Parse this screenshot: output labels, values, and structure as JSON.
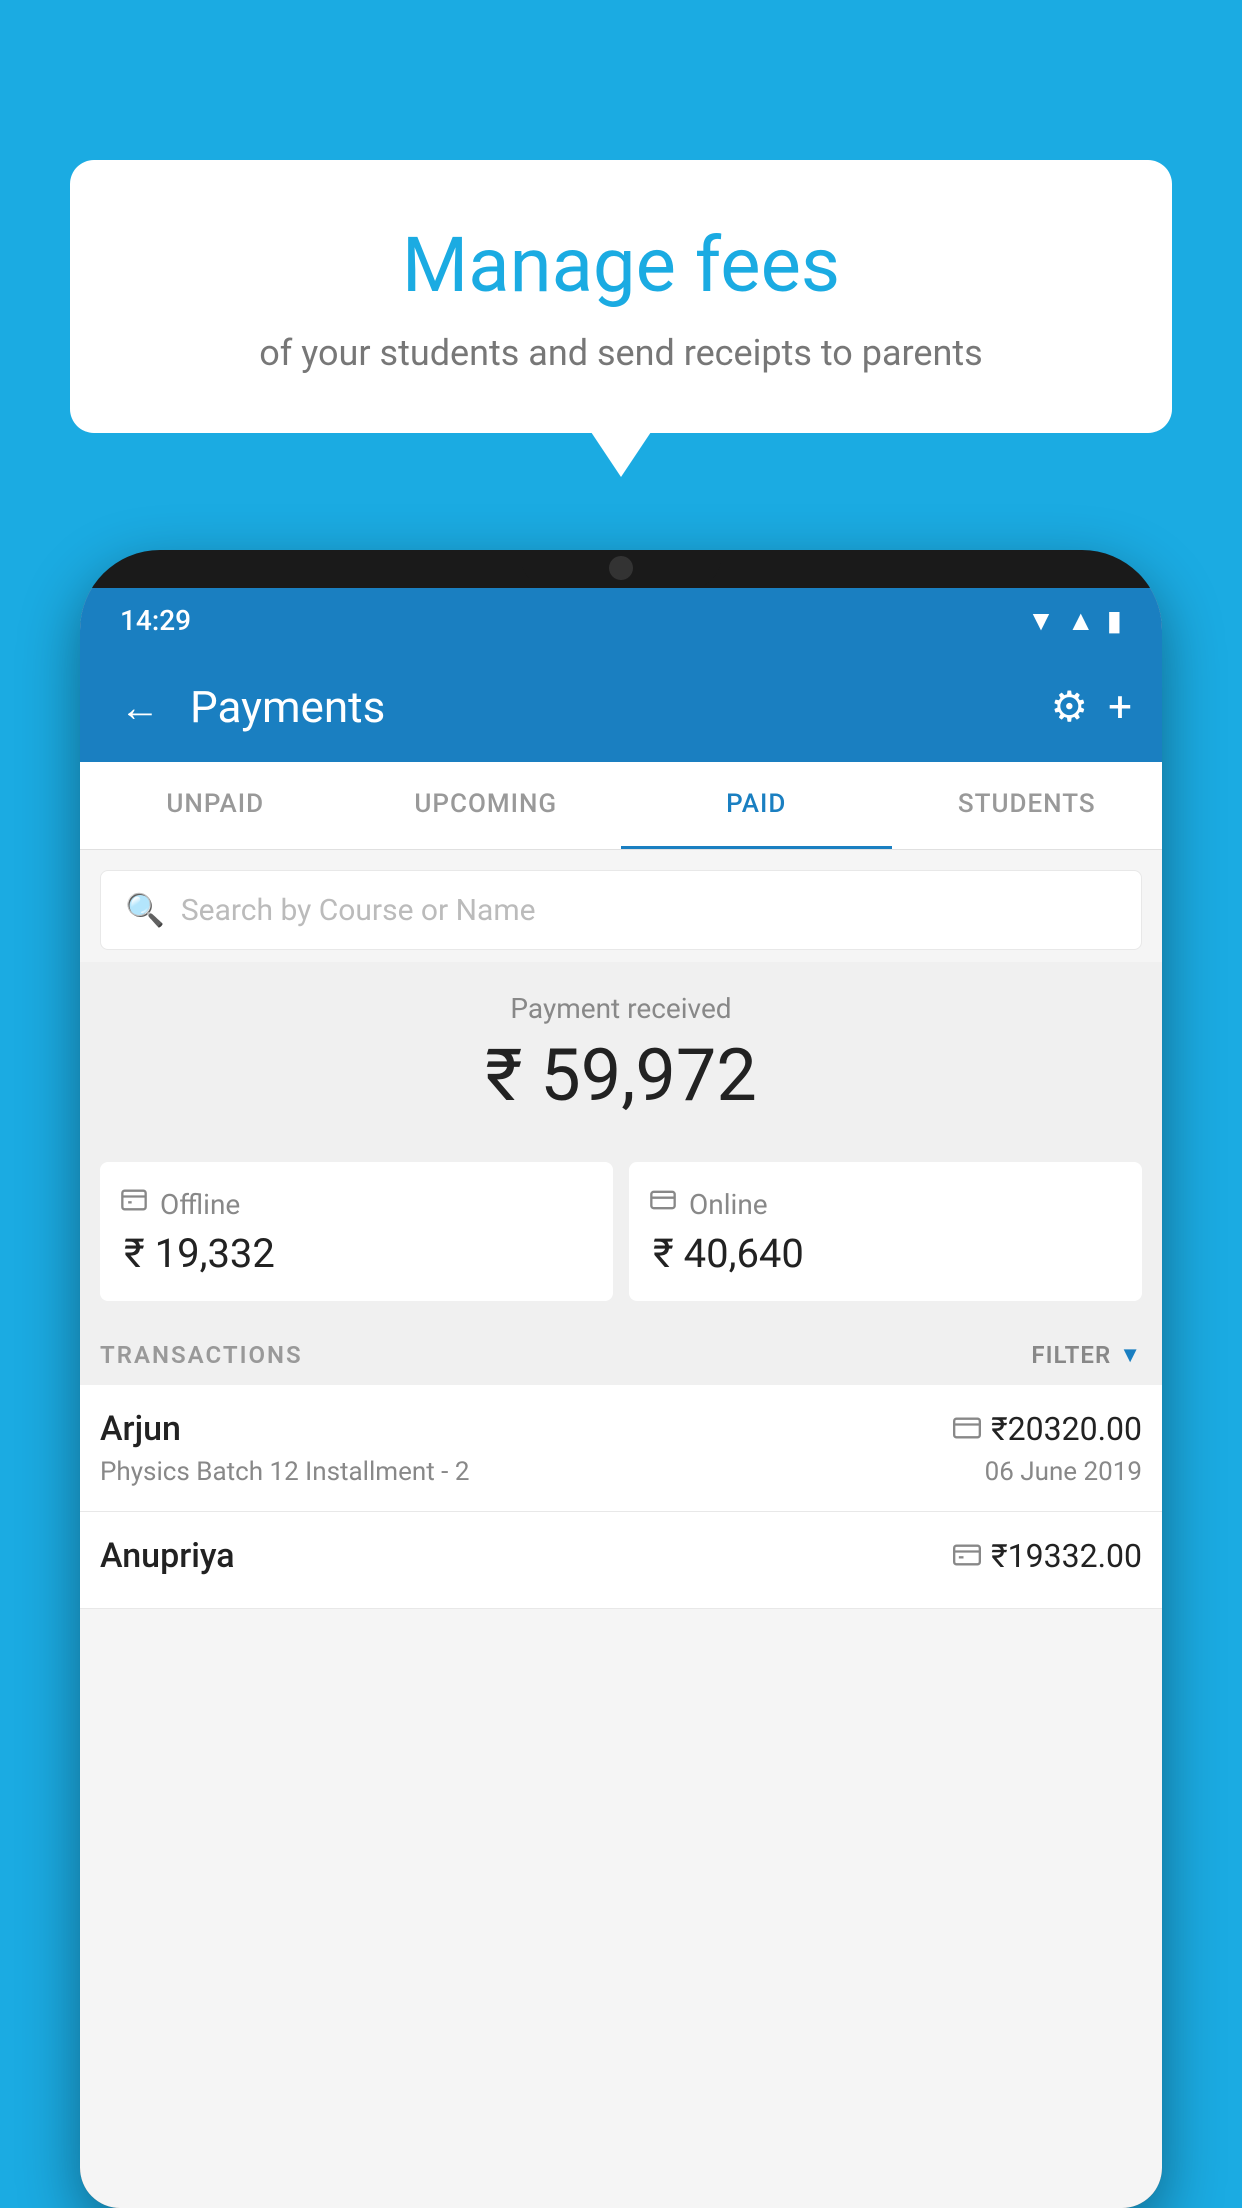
{
  "background_color": "#1BABE2",
  "speech_bubble": {
    "title": "Manage fees",
    "subtitle": "of your students and send receipts to parents"
  },
  "status_bar": {
    "time": "14:29",
    "wifi_icon": "▼",
    "signal_icon": "▲",
    "battery_icon": "▮"
  },
  "app_bar": {
    "title": "Payments",
    "back_label": "←",
    "gear_label": "⚙",
    "plus_label": "+"
  },
  "tabs": [
    {
      "label": "UNPAID",
      "active": false
    },
    {
      "label": "UPCOMING",
      "active": false
    },
    {
      "label": "PAID",
      "active": true
    },
    {
      "label": "STUDENTS",
      "active": false
    }
  ],
  "search": {
    "placeholder": "Search by Course or Name"
  },
  "payment_section": {
    "label": "Payment received",
    "amount": "₹ 59,972"
  },
  "payment_cards": [
    {
      "icon": "💳",
      "label": "Offline",
      "amount": "₹ 19,332"
    },
    {
      "icon": "💳",
      "label": "Online",
      "amount": "₹ 40,640"
    }
  ],
  "transactions_label": "TRANSACTIONS",
  "filter_label": "FILTER",
  "transactions": [
    {
      "name": "Arjun",
      "course": "Physics Batch 12 Installment - 2",
      "amount": "₹20320.00",
      "date": "06 June 2019",
      "type": "online"
    },
    {
      "name": "Anupriya",
      "course": "",
      "amount": "₹19332.00",
      "date": "",
      "type": "offline"
    }
  ]
}
